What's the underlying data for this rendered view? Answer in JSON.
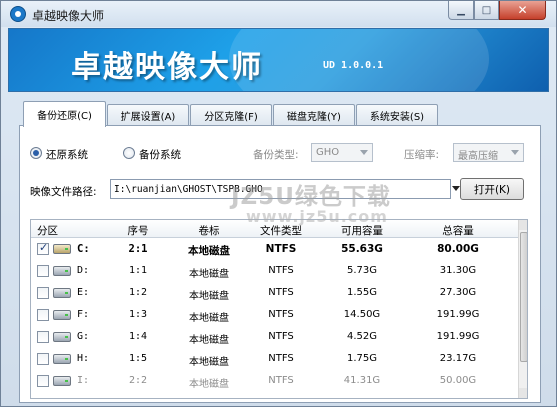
{
  "window": {
    "title": "卓越映像大师"
  },
  "banner": {
    "title": "卓越映像大师",
    "version": "UD 1.0.0.1"
  },
  "tabs": [
    {
      "label": "备份还原(C)",
      "active": true
    },
    {
      "label": "扩展设置(A)",
      "active": false
    },
    {
      "label": "分区克隆(F)",
      "active": false
    },
    {
      "label": "磁盘克隆(Y)",
      "active": false
    },
    {
      "label": "系统安装(S)",
      "active": false
    }
  ],
  "options": {
    "restore_label": "还原系统",
    "restore_selected": true,
    "backup_label": "备份系统",
    "backup_type_label": "备份类型:",
    "backup_type_value": "GHO",
    "compression_label": "压缩率:",
    "compression_value": "最高压缩"
  },
  "image_path": {
    "label": "映像文件路径:",
    "value": "I:\\ruanjian\\GHOST\\TSPB.GHO",
    "open_button": "打开(K)"
  },
  "table": {
    "columns": [
      "分区",
      "序号",
      "卷标",
      "文件类型",
      "可用容量",
      "总容量"
    ],
    "rows": [
      {
        "checked": true,
        "drive": "C:",
        "index": "2:1",
        "label": "本地磁盘",
        "fs": "NTFS",
        "free": "55.63G",
        "total": "80.00G",
        "style": "bold"
      },
      {
        "checked": false,
        "drive": "D:",
        "index": "1:1",
        "label": "本地磁盘",
        "fs": "NTFS",
        "free": "5.73G",
        "total": "31.30G",
        "style": "normal"
      },
      {
        "checked": false,
        "drive": "E:",
        "index": "1:2",
        "label": "本地磁盘",
        "fs": "NTFS",
        "free": "1.55G",
        "total": "27.30G",
        "style": "normal"
      },
      {
        "checked": false,
        "drive": "F:",
        "index": "1:3",
        "label": "本地磁盘",
        "fs": "NTFS",
        "free": "14.50G",
        "total": "191.99G",
        "style": "normal"
      },
      {
        "checked": false,
        "drive": "G:",
        "index": "1:4",
        "label": "本地磁盘",
        "fs": "NTFS",
        "free": "4.52G",
        "total": "191.99G",
        "style": "normal"
      },
      {
        "checked": false,
        "drive": "H:",
        "index": "1:5",
        "label": "本地磁盘",
        "fs": "NTFS",
        "free": "1.75G",
        "total": "23.17G",
        "style": "normal"
      },
      {
        "checked": false,
        "drive": "I:",
        "index": "2:2",
        "label": "本地磁盘",
        "fs": "NTFS",
        "free": "41.31G",
        "total": "50.00G",
        "style": "faded"
      }
    ]
  },
  "watermark": {
    "text": "JZ5U绿色下载",
    "url": "www.jz5u.com"
  }
}
